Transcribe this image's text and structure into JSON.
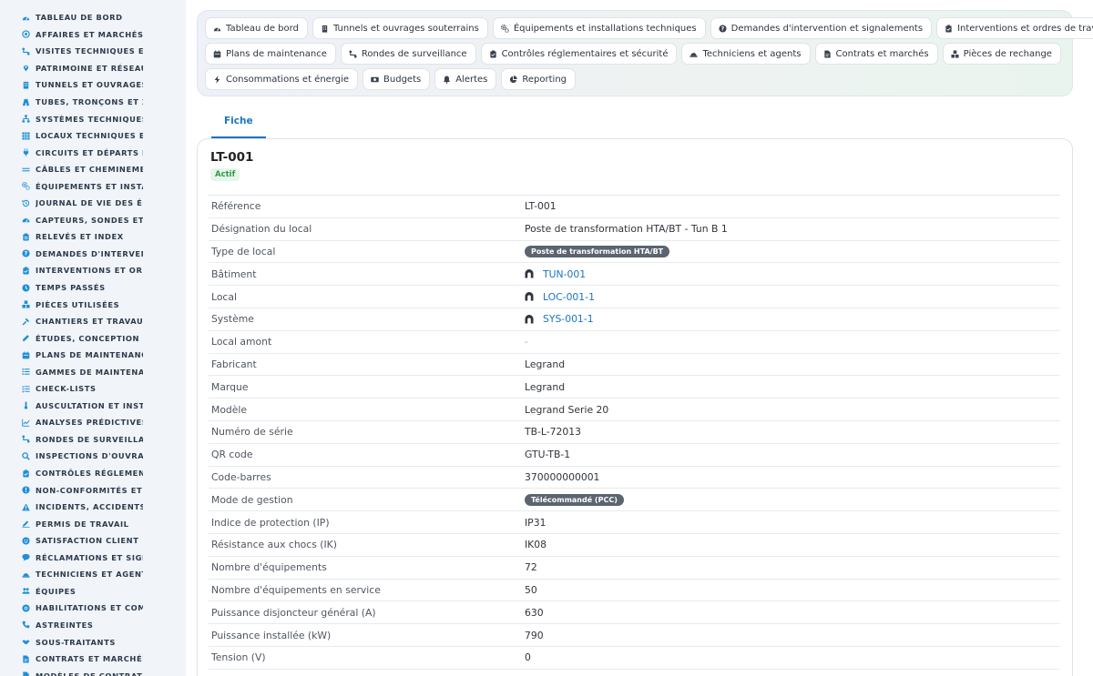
{
  "theme": {
    "accent": "#1a74c1",
    "icon_blue": "#1f8fd6",
    "active_green": "#2f9a4a",
    "pill_grey": "#5b6470"
  },
  "sidebar": {
    "items": [
      {
        "label": "TABLEAU DE BORD",
        "icon": "dashboard-icon"
      },
      {
        "label": "AFFAIRES ET MARCHÉS",
        "icon": "target-icon"
      },
      {
        "label": "VISITES TECHNIQUES ET",
        "icon": "route-icon"
      },
      {
        "label": "PATRIMOINE ET RÉSEAUX",
        "icon": "map-pin-icon"
      },
      {
        "label": "TUNNELS ET OUVRAGES",
        "icon": "building-icon"
      },
      {
        "label": "TUBES, TRONÇONS ET ZO",
        "icon": "road-icon"
      },
      {
        "label": "SYSTÈMES TECHNIQUES",
        "icon": "sitemap-icon"
      },
      {
        "label": "LOCAUX TECHNIQUES ET",
        "icon": "grid-icon"
      },
      {
        "label": "CIRCUITS ET DÉPARTS ÉL",
        "icon": "plug-icon"
      },
      {
        "label": "CÂBLES ET CHEMINEMEN",
        "icon": "lines-icon"
      },
      {
        "label": "ÉQUIPEMENTS ET INSTAL",
        "icon": "gears-icon"
      },
      {
        "label": "JOURNAL DE VIE DES ÉQ",
        "icon": "history-icon"
      },
      {
        "label": "CAPTEURS, SONDES ET C",
        "icon": "gauge-icon"
      },
      {
        "label": "RELEVÉS ET INDEX",
        "icon": "clipboard-icon"
      },
      {
        "label": "DEMANDES D'INTERVENT",
        "icon": "question-icon"
      },
      {
        "label": "INTERVENTIONS ET ORDI",
        "icon": "clipboard-check-icon"
      },
      {
        "label": "TEMPS PASSÉS",
        "icon": "clock-icon"
      },
      {
        "label": "PIÈCES UTILISÉES",
        "icon": "boxes-icon"
      },
      {
        "label": "CHANTIERS ET TRAVAUX",
        "icon": "hammer-icon"
      },
      {
        "label": "ÉTUDES, CONCEPTION ET",
        "icon": "pencil-ruler-icon"
      },
      {
        "label": "PLANS DE MAINTENANCE",
        "icon": "calendar-icon"
      },
      {
        "label": "GAMMES DE MAINTENAN",
        "icon": "list-icon"
      },
      {
        "label": "CHECK-LISTS",
        "icon": "checklist-icon"
      },
      {
        "label": "AUSCULTATION ET INSTR",
        "icon": "thermometer-icon"
      },
      {
        "label": "ANALYSES PRÉDICTIVES",
        "icon": "chart-line-icon"
      },
      {
        "label": "RONDES DE SURVEILLAN",
        "icon": "route-icon"
      },
      {
        "label": "INSPECTIONS D'OUVRAG",
        "icon": "magnifier-icon"
      },
      {
        "label": "CONTRÔLES RÉGLEMENT",
        "icon": "clipboard-check-icon"
      },
      {
        "label": "NON-CONFORMITÉS ET A",
        "icon": "alert-circle-icon"
      },
      {
        "label": "INCIDENTS, ACCIDENTS E",
        "icon": "warning-icon"
      },
      {
        "label": "PERMIS DE TRAVAIL",
        "icon": "signature-icon"
      },
      {
        "label": "SATISFACTION CLIENT",
        "icon": "smile-icon"
      },
      {
        "label": "RÉCLAMATIONS ET SIGNA",
        "icon": "comment-icon"
      },
      {
        "label": "TECHNICIENS ET AGENTS",
        "icon": "helmet-icon"
      },
      {
        "label": "ÉQUIPES",
        "icon": "users-icon"
      },
      {
        "label": "HABILITATIONS ET COMP",
        "icon": "certificate-icon"
      },
      {
        "label": "ASTREINTES",
        "icon": "phone-icon"
      },
      {
        "label": "SOUS-TRAITANTS",
        "icon": "handshake-icon"
      },
      {
        "label": "CONTRATS ET MARCHÉS",
        "icon": "file-contract-icon"
      },
      {
        "label": "MODÈLES DE CONTRATS",
        "icon": "file-icon"
      }
    ]
  },
  "shortcuts": {
    "row1": [
      {
        "label": "Tableau de bord",
        "icon": "dashboard-icon"
      },
      {
        "label": "Tunnels et ouvrages souterrains",
        "icon": "building-icon"
      },
      {
        "label": "Équipements et installations techniques",
        "icon": "gears-icon"
      },
      {
        "label": "Demandes d'intervention et signalements",
        "icon": "question-icon"
      },
      {
        "label": "Interventions et ordres de travail",
        "icon": "clipboard-check-icon"
      }
    ],
    "row2": [
      {
        "label": "Plans de maintenance",
        "icon": "calendar-icon"
      },
      {
        "label": "Rondes de surveillance",
        "icon": "route-icon"
      },
      {
        "label": "Contrôles réglementaires et sécurité",
        "icon": "clipboard-check-icon"
      },
      {
        "label": "Techniciens et agents",
        "icon": "helmet-icon"
      },
      {
        "label": "Contrats et marchés",
        "icon": "file-contract-icon"
      },
      {
        "label": "Pièces de rechange",
        "icon": "boxes-icon"
      }
    ],
    "row3": [
      {
        "label": "Consommations et énergie",
        "icon": "bolt-icon"
      },
      {
        "label": "Budgets",
        "icon": "money-icon"
      },
      {
        "label": "Alertes",
        "icon": "bell-icon"
      },
      {
        "label": "Reporting",
        "icon": "pie-chart-icon"
      }
    ]
  },
  "tabs": [
    {
      "label": "Fiche",
      "active": true
    }
  ],
  "record": {
    "title": "LT-001",
    "status": "Actif",
    "fields": [
      {
        "label": "Référence",
        "value": "LT-001",
        "kind": "text"
      },
      {
        "label": "Désignation du local",
        "value": "Poste de transformation HTA/BT - Tun B 1",
        "kind": "text"
      },
      {
        "label": "Type de local",
        "value": "Poste de transformation HTA/BT",
        "kind": "pill"
      },
      {
        "label": "Bâtiment",
        "value": "TUN-001",
        "kind": "link",
        "icon": "tunnel-icon"
      },
      {
        "label": "Local",
        "value": "LOC-001-1",
        "kind": "link",
        "icon": "tunnel-icon"
      },
      {
        "label": "Système",
        "value": "SYS-001-1",
        "kind": "link",
        "icon": "tunnel-icon"
      },
      {
        "label": "Local amont",
        "value": "-",
        "kind": "empty"
      },
      {
        "label": "Fabricant",
        "value": "Legrand",
        "kind": "text"
      },
      {
        "label": "Marque",
        "value": "Legrand",
        "kind": "text"
      },
      {
        "label": "Modèle",
        "value": "Legrand Serie 20",
        "kind": "text"
      },
      {
        "label": "Numéro de série",
        "value": "TB-L-72013",
        "kind": "text"
      },
      {
        "label": "QR code",
        "value": "GTU-TB-1",
        "kind": "text"
      },
      {
        "label": "Code-barres",
        "value": "370000000001",
        "kind": "text"
      },
      {
        "label": "Mode de gestion",
        "value": "Télécommandé (PCC)",
        "kind": "pill"
      },
      {
        "label": "Indice de protection (IP)",
        "value": "IP31",
        "kind": "text"
      },
      {
        "label": "Résistance aux chocs (IK)",
        "value": "IK08",
        "kind": "text"
      },
      {
        "label": "Nombre d'équipements",
        "value": "72",
        "kind": "text"
      },
      {
        "label": "Nombre d'équipements en service",
        "value": "50",
        "kind": "text"
      },
      {
        "label": "Puissance disjoncteur général (A)",
        "value": "630",
        "kind": "text"
      },
      {
        "label": "Puissance installée (kW)",
        "value": "790",
        "kind": "text"
      },
      {
        "label": "Tension (V)",
        "value": "0",
        "kind": "text"
      }
    ]
  }
}
